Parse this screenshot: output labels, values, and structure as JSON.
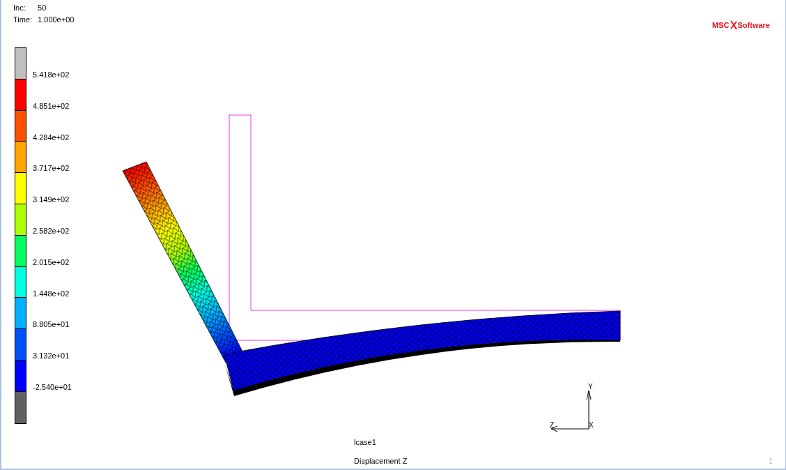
{
  "header": {
    "increment_label": "Inc:",
    "increment": "50",
    "time_label": "Time:",
    "time": "1.000e+00"
  },
  "logo": {
    "left": "MSC",
    "right": "Software"
  },
  "legend": {
    "bands": [
      {
        "color": "#c0c0c0"
      },
      {
        "color": "#ff0000"
      },
      {
        "color": "#ff5000"
      },
      {
        "color": "#ffa500"
      },
      {
        "color": "#ffff00"
      },
      {
        "color": "#b0ff00"
      },
      {
        "color": "#00ff60"
      },
      {
        "color": "#00ffe0"
      },
      {
        "color": "#00b0ff"
      },
      {
        "color": "#0050ff"
      },
      {
        "color": "#0000ff"
      },
      {
        "color": "#606060"
      }
    ],
    "labels": [
      "5.418e+02",
      "4.851e+02",
      "4.284e+02",
      "3.717e+02",
      "3.149e+02",
      "2.582e+02",
      "2.015e+02",
      "1.448e+02",
      "8.805e+01",
      "3.132e+01",
      "-2.540e+01"
    ]
  },
  "triad": {
    "y": "Y",
    "z": "Z",
    "x": "X"
  },
  "load_case": "lcase1",
  "result": "Displacement Z",
  "page": "1"
}
